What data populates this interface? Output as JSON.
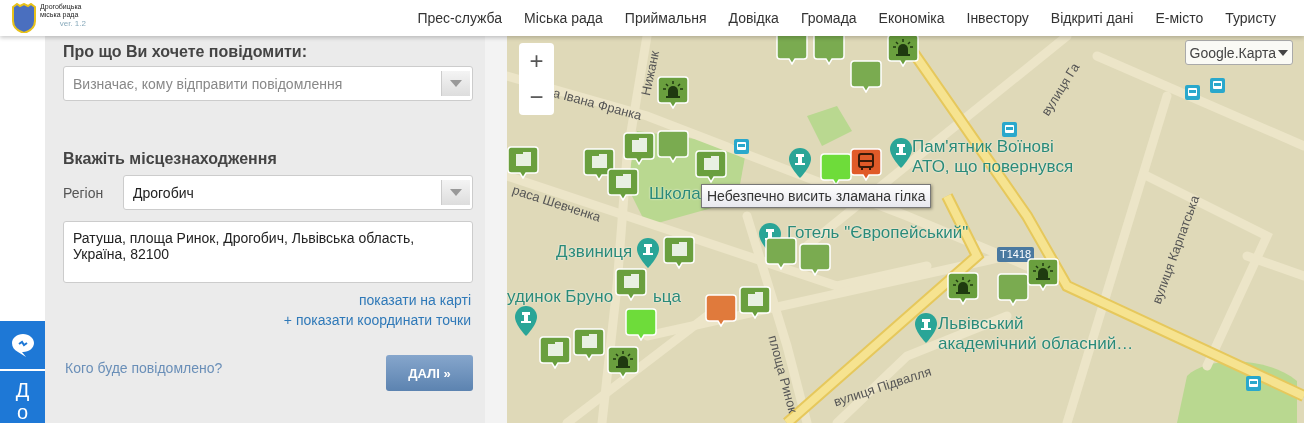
{
  "logo": {
    "title": "Дрогобицька міська рада",
    "version": "ver. 1.2"
  },
  "nav": [
    "Прес-служба",
    "Міська рада",
    "Приймальня",
    "Довідка",
    "Громада",
    "Економіка",
    "Інвестору",
    "Відкриті дані",
    "Е-місто",
    "Туристу"
  ],
  "side_tabs": [
    {
      "kind": "chat"
    },
    {
      "kind": "text",
      "label": "До"
    }
  ],
  "form": {
    "topic_heading": "Про що Ви хочете повідомити:",
    "topic_placeholder": "Визначає, кому відправити повідомлення",
    "location_heading": "Вкажіть місцезнаходження",
    "region_label": "Регіон",
    "region_value": "Дрогобич",
    "address": "Ратуша, площа Ринок, Дрогобич, Львівська область, Україна, 82100",
    "links": [
      "показати на карті",
      "+ показати координати точки"
    ],
    "who_link": "Кого буде повідомлено?",
    "next_button": "ДАЛІ »"
  },
  "map": {
    "zoom_in": "+",
    "zoom_out": "−",
    "map_type": "Google.Карта",
    "tooltip": "Небезпечно висить зламана гілка",
    "labels": [
      {
        "kind": "street",
        "text": "а Івана Франка"
      },
      {
        "kind": "street",
        "text": "Нижанк"
      },
      {
        "kind": "street",
        "text": "раса Шевченка"
      },
      {
        "kind": "street",
        "text": "площа Ринок"
      },
      {
        "kind": "street",
        "text": "вулиця Підвалля"
      },
      {
        "kind": "street",
        "text": "вулиця Га"
      },
      {
        "kind": "street",
        "text": "вулиця Карпатська"
      },
      {
        "kind": "place",
        "text": "Школа"
      },
      {
        "kind": "place",
        "text": "Пам'ятник Воїнові\nАТО, що повернувся"
      },
      {
        "kind": "place",
        "text": "Готель \"Європейський\""
      },
      {
        "kind": "place",
        "text": "Дзвиниця"
      },
      {
        "kind": "place",
        "text": "удинок Бруно"
      },
      {
        "kind": "place",
        "text": "ьца"
      },
      {
        "kind": "place",
        "text": "Львівський\nакадемічний обласний…"
      },
      {
        "kind": "shield",
        "text": "T1418"
      }
    ],
    "markers": [
      {
        "kind": "building",
        "color": "#6a9f3e"
      },
      {
        "kind": "building",
        "color": "#6a9f3e"
      },
      {
        "kind": "building",
        "color": "#6a9f3e"
      },
      {
        "kind": "building",
        "color": "#6a9f3e"
      },
      {
        "kind": "building",
        "color": "#6a9f3e"
      },
      {
        "kind": "building",
        "color": "#6a9f3e"
      },
      {
        "kind": "building",
        "color": "#6a9f3e"
      },
      {
        "kind": "building",
        "color": "#6a9f3e"
      },
      {
        "kind": "speech",
        "color": "#e07a3c"
      },
      {
        "kind": "building",
        "color": "#6a9f3e"
      },
      {
        "kind": "building",
        "color": "#6a9f3e"
      },
      {
        "kind": "speech",
        "color": "#7aab50"
      },
      {
        "kind": "speech",
        "color": "#7aab50"
      },
      {
        "kind": "speech",
        "color": "#7aab50"
      },
      {
        "kind": "speech",
        "color": "#7aab50"
      },
      {
        "kind": "speech",
        "color": "#7aab50"
      },
      {
        "kind": "speech",
        "color": "#7aab50"
      },
      {
        "kind": "speech",
        "color": "#7aab50"
      },
      {
        "kind": "speech",
        "color": "#6edc3a"
      },
      {
        "kind": "speech",
        "color": "#6edc3a"
      },
      {
        "kind": "siren",
        "color": "#6a9f3e"
      },
      {
        "kind": "siren",
        "color": "#6a9f3e"
      },
      {
        "kind": "siren",
        "color": "#6a9f3e"
      },
      {
        "kind": "siren",
        "color": "#6a9f3e"
      },
      {
        "kind": "siren",
        "color": "#6a9f3e"
      },
      {
        "kind": "bus",
        "color": "#e05a28"
      }
    ]
  }
}
